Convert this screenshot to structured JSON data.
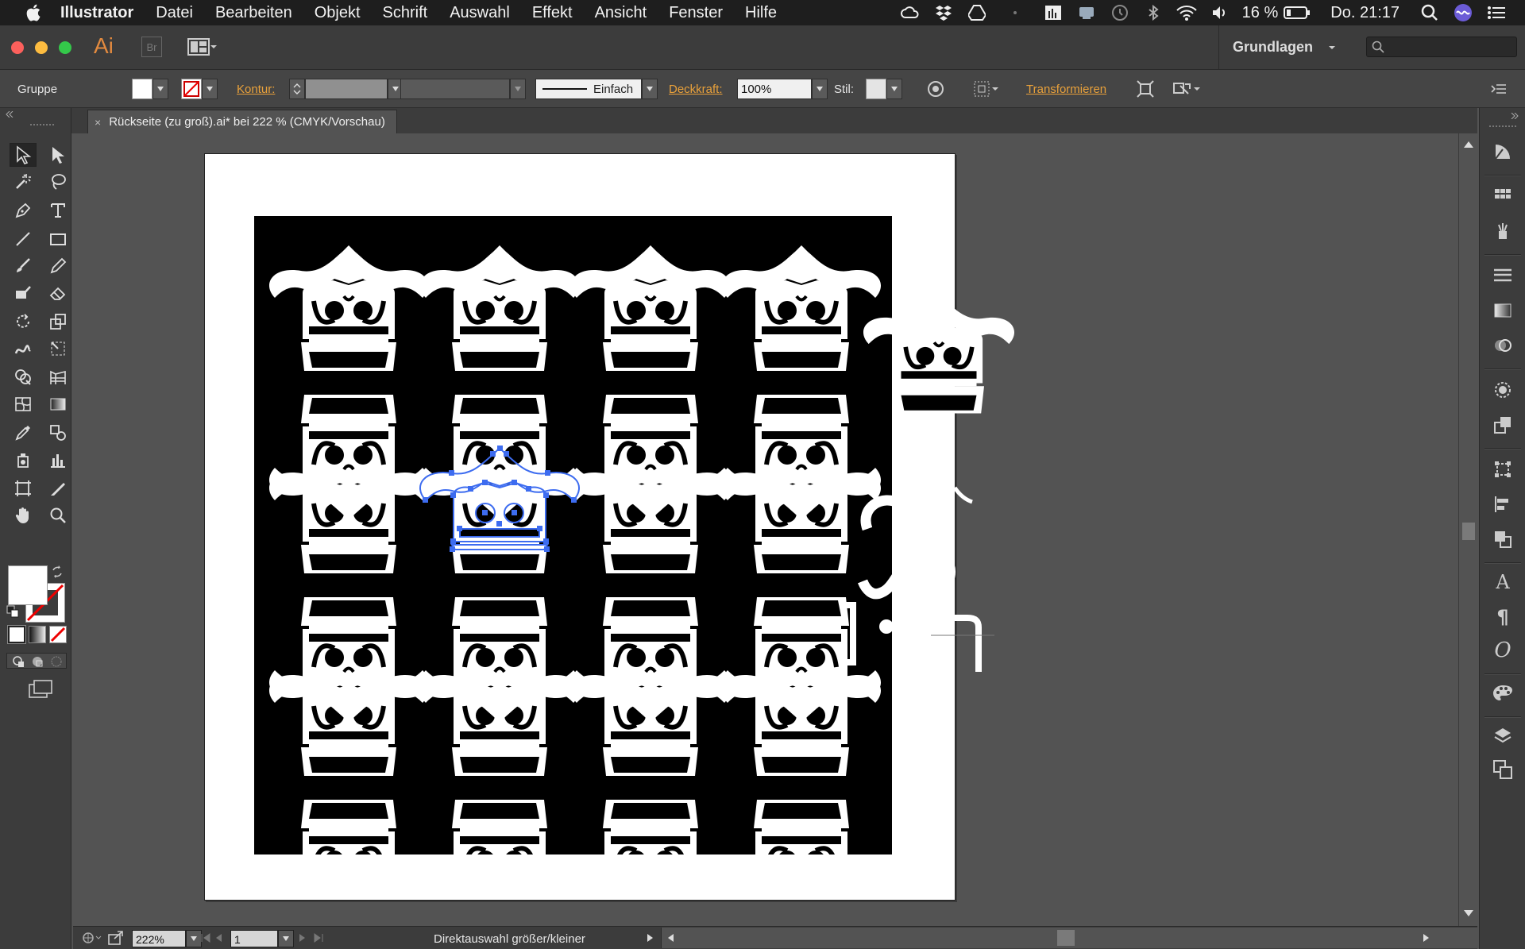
{
  "menubar": {
    "app_name": "Illustrator",
    "items": [
      "Datei",
      "Bearbeiten",
      "Objekt",
      "Schrift",
      "Auswahl",
      "Effekt",
      "Ansicht",
      "Fenster",
      "Hilfe"
    ],
    "battery": "16 %",
    "clock": "Do. 21:17"
  },
  "titlebar": {
    "app_logo": "Ai",
    "bridge_label": "Br",
    "workspace": "Grundlagen"
  },
  "controlbar": {
    "selection_type": "Gruppe",
    "stroke_label": "Kontur:",
    "stroke_style": "Einfach",
    "opacity_label": "Deckkraft:",
    "opacity_value": "100%",
    "style_label": "Stil:",
    "transform_link": "Transformieren"
  },
  "document": {
    "tab_title": "Rückseite (zu groß).ai* bei 222 % (CMYK/Vorschau)"
  },
  "statusbar": {
    "zoom": "222%",
    "artboard_number": "1",
    "status_text": "Direktauswahl größer/kleiner"
  },
  "colors": {
    "accent_link": "#e9a13b",
    "selection_blue": "#3d6cf0",
    "canvas_bg": "#535353",
    "panel_bg": "#3c3c3c"
  }
}
